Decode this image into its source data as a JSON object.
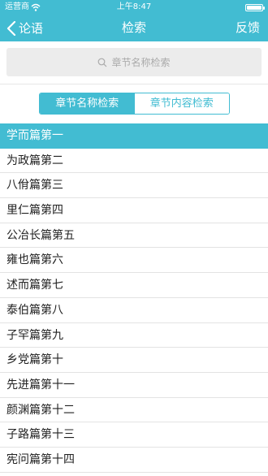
{
  "status_bar": {
    "carrier": "运营商",
    "time": "上午8:47",
    "battery_level": 1.0
  },
  "nav": {
    "back_label": "论语",
    "title": "检索",
    "feedback_label": "反馈"
  },
  "search": {
    "placeholder": "章节名称检索"
  },
  "segments": {
    "chapter_name": "章节名称检索",
    "chapter_content": "章节内容检索"
  },
  "chapters": [
    "学而篇第一",
    "为政篇第二",
    "八佾篇第三",
    "里仁篇第四",
    "公冶长篇第五",
    "雍也篇第六",
    "述而篇第七",
    "泰伯篇第八",
    "子罕篇第九",
    "乡党篇第十",
    "先进篇第十一",
    "颜渊篇第十二",
    "子路篇第十三",
    "宪问篇第十四"
  ],
  "colors": {
    "accent": "#42bcd2"
  }
}
